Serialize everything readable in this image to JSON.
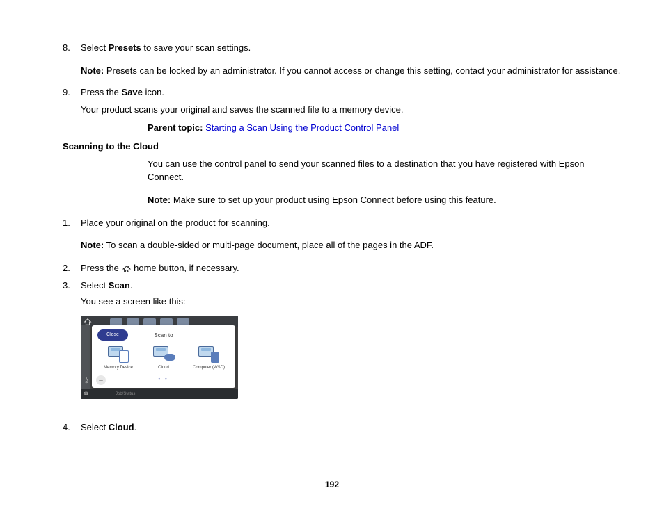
{
  "step8": {
    "num": "8",
    "prefix": "Select ",
    "bold": "Presets",
    "suffix": " to save your scan settings.",
    "noteLabel": "Note:",
    "noteBody": " Presets can be locked by an administrator. If you cannot access or change this setting, contact your administrator for assistance."
  },
  "step9": {
    "num": "9",
    "prefix": "Press the ",
    "bold": "Save",
    "suffix": " icon.",
    "result": "Your product scans your original and saves the scanned file to a memory device."
  },
  "parentTopic": {
    "label": "Parent topic: ",
    "linkText": "Starting a Scan Using the Product Control Panel"
  },
  "cloud": {
    "heading": "Scanning to the Cloud",
    "intro": "You can use the control panel to send your scanned files to a destination that you have registered with Epson Connect.",
    "noteLabel": "Note:",
    "noteBody": " Make sure to set up your product using Epson Connect before using this feature.",
    "step1": {
      "num": "1",
      "text": "Place your original on the product for scanning.",
      "subNoteLabel": "Note:",
      "subNoteBody": " To scan a double-sided or multi-page document, place all of the pages in the ADF."
    },
    "step2": {
      "num": "2",
      "prefix": "Press the ",
      "suffix": " home button, if necessary."
    },
    "step3": {
      "num": "3",
      "prefix": "Select ",
      "bold": "Scan",
      "suffix": ".",
      "result": "You see a screen like this:"
    },
    "step4": {
      "num": "4",
      "prefix": "Select ",
      "bold": "Cloud",
      "suffix": "."
    }
  },
  "screenshot": {
    "close": "Close",
    "title": "Scan to",
    "icons": [
      {
        "label": "Memory Device"
      },
      {
        "label": "Cloud"
      },
      {
        "label": "Computer (WSD)"
      }
    ],
    "leftStrip": "Pro",
    "bottomMid": "Job/Status",
    "bottomRight": ""
  },
  "pageNumber": "192"
}
